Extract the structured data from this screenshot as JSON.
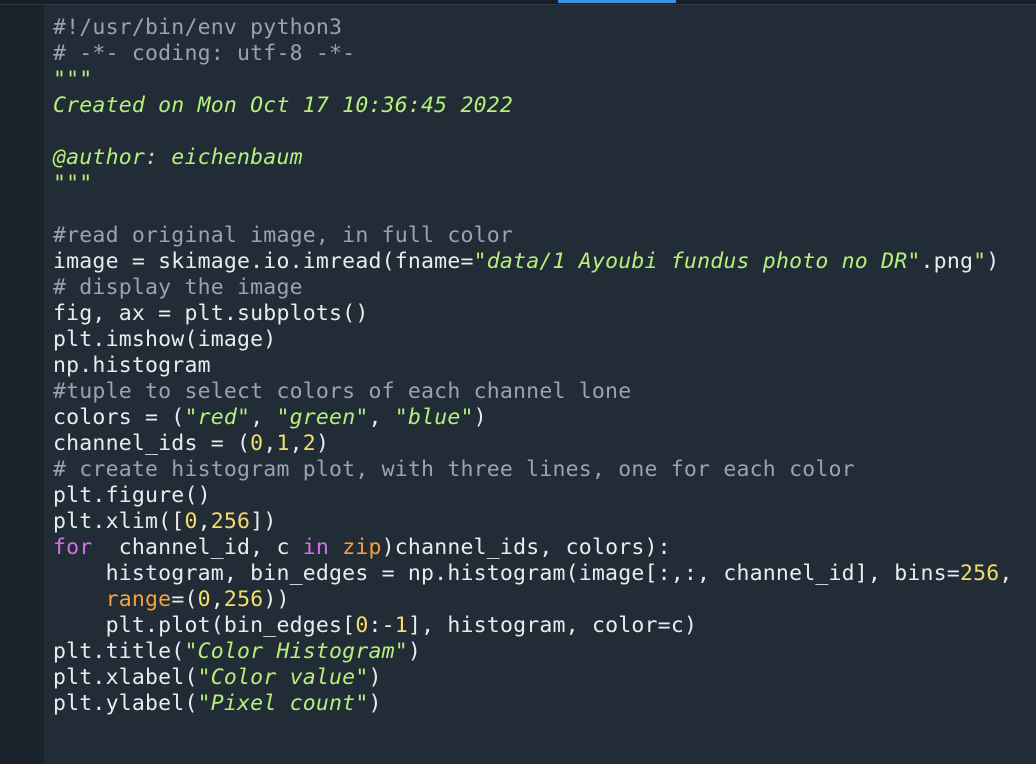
{
  "editor": {
    "accent_color": "#3d8fe0",
    "background": "#222c37",
    "lines": [
      [
        {
          "t": "#!/usr/bin/env python3",
          "c": "c"
        }
      ],
      [
        {
          "t": "# -*- coding: utf-8 -*-",
          "c": "c"
        }
      ],
      [
        {
          "t": "\"\"\"",
          "c": "d"
        }
      ],
      [
        {
          "t": "Created on Mon Oct 17 10:36:45 2022",
          "c": "d"
        }
      ],
      [],
      [
        {
          "t": "@author: eichenbaum",
          "c": "d"
        }
      ],
      [
        {
          "t": "\"\"\"",
          "c": "d"
        }
      ],
      [],
      [
        {
          "t": "#read original image, in full color",
          "c": "c"
        }
      ],
      [
        {
          "t": "image = skimage.io.imread(fname=",
          "c": "p"
        },
        {
          "t": "\"data/1 Ayoubi fundus photo no DR\"",
          "c": "s"
        },
        {
          "t": ".png",
          "c": "p"
        },
        {
          "t": "\"",
          "c": "s"
        },
        {
          "t": ")",
          "c": "p"
        }
      ],
      [
        {
          "t": "# display the image",
          "c": "c"
        }
      ],
      [
        {
          "t": "fig, ax = plt.subplots()",
          "c": "p"
        }
      ],
      [
        {
          "t": "plt.imshow(image)",
          "c": "p"
        }
      ],
      [
        {
          "t": "np.histogram",
          "c": "p"
        }
      ],
      [
        {
          "t": "#tuple to select colors of each channel lone",
          "c": "c"
        }
      ],
      [
        {
          "t": "colors = (",
          "c": "p"
        },
        {
          "t": "\"red\"",
          "c": "s"
        },
        {
          "t": ", ",
          "c": "p"
        },
        {
          "t": "\"green\"",
          "c": "s"
        },
        {
          "t": ", ",
          "c": "p"
        },
        {
          "t": "\"blue\"",
          "c": "s"
        },
        {
          "t": ")",
          "c": "p"
        }
      ],
      [
        {
          "t": "channel_ids = (",
          "c": "p"
        },
        {
          "t": "0",
          "c": "n"
        },
        {
          "t": ",",
          "c": "p"
        },
        {
          "t": "1",
          "c": "n"
        },
        {
          "t": ",",
          "c": "p"
        },
        {
          "t": "2",
          "c": "n"
        },
        {
          "t": ")",
          "c": "p"
        }
      ],
      [
        {
          "t": "# create histogram plot, with three lines, one for each color",
          "c": "c"
        }
      ],
      [
        {
          "t": "plt.figure()",
          "c": "p"
        }
      ],
      [
        {
          "t": "plt.xlim([",
          "c": "p"
        },
        {
          "t": "0",
          "c": "n"
        },
        {
          "t": ",",
          "c": "p"
        },
        {
          "t": "256",
          "c": "n"
        },
        {
          "t": "])",
          "c": "p"
        }
      ],
      [
        {
          "t": "for",
          "c": "k"
        },
        {
          "t": "  channel_id, c ",
          "c": "p"
        },
        {
          "t": "in",
          "c": "k"
        },
        {
          "t": " ",
          "c": "p"
        },
        {
          "t": "zip",
          "c": "b"
        },
        {
          "t": ")channel_ids, colors):",
          "c": "p"
        }
      ],
      [
        {
          "t": "    histogram, bin_edges = np.histogram(image[:,:, channel_id], bins=",
          "c": "p"
        },
        {
          "t": "256",
          "c": "n"
        },
        {
          "t": ",",
          "c": "p"
        }
      ],
      [
        {
          "t": "    ",
          "c": "p"
        },
        {
          "t": "range",
          "c": "b"
        },
        {
          "t": "=(",
          "c": "p"
        },
        {
          "t": "0",
          "c": "n"
        },
        {
          "t": ",",
          "c": "p"
        },
        {
          "t": "256",
          "c": "n"
        },
        {
          "t": "))",
          "c": "p"
        }
      ],
      [
        {
          "t": "    plt.plot(bin_edges[",
          "c": "p"
        },
        {
          "t": "0",
          "c": "n"
        },
        {
          "t": ":-",
          "c": "p"
        },
        {
          "t": "1",
          "c": "n"
        },
        {
          "t": "], histogram, color=c)",
          "c": "p"
        }
      ],
      [
        {
          "t": "plt.title(",
          "c": "p"
        },
        {
          "t": "\"Color Histogram\"",
          "c": "s"
        },
        {
          "t": ")",
          "c": "p"
        }
      ],
      [
        {
          "t": "plt.xlabel(",
          "c": "p"
        },
        {
          "t": "\"Color value\"",
          "c": "s"
        },
        {
          "t": ")",
          "c": "p"
        }
      ],
      [
        {
          "t": "plt.ylabel(",
          "c": "p"
        },
        {
          "t": "\"Pixel count\"",
          "c": "s"
        },
        {
          "t": ")",
          "c": "p"
        }
      ]
    ]
  }
}
